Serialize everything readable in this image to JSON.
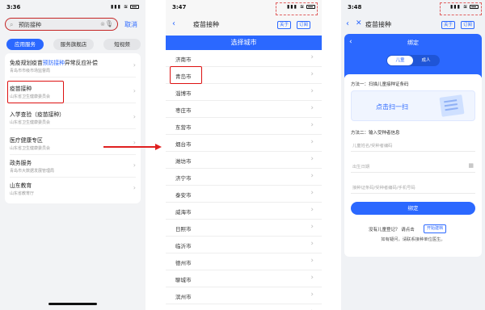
{
  "phone1": {
    "time": "3:36",
    "search": {
      "value": "预防接种",
      "cancel": "取消"
    },
    "tabs": [
      "应用服务",
      "服务旗舰店",
      "短视频"
    ],
    "results": [
      {
        "title_pre": "免疫规划疫苗",
        "title_hl": "预防接种",
        "title_post": "异常反应补偿",
        "sub": "青岛市市级市场监督局"
      },
      {
        "title_pre": "",
        "title_hl": "疫苗接种",
        "title_post": "",
        "sub": "山东省卫生健康委员会"
      },
      {
        "title_pre": "入学查验（",
        "title_hl": "疫苗接种",
        "title_post": "）",
        "sub": "山东省卫生健康委员会"
      },
      {
        "title_pre": "医疗健康专区",
        "title_hl": "",
        "title_post": "",
        "sub": "山东省卫生健康委员会"
      },
      {
        "title_pre": "政务服务",
        "title_hl": "",
        "title_post": "",
        "sub": "青岛市大数据发展管理局"
      },
      {
        "title_pre": "山东教育",
        "title_hl": "",
        "title_post": "",
        "sub": "山东省教育厅"
      }
    ]
  },
  "phone2": {
    "time": "3:47",
    "nav_title": "疫苗接种",
    "pill_about": "关于",
    "pill_sub": "订阅",
    "banner": "选择城市",
    "cities": [
      "济南市",
      "青岛市",
      "淄博市",
      "枣庄市",
      "东营市",
      "烟台市",
      "潍坊市",
      "济宁市",
      "泰安市",
      "威海市",
      "日照市",
      "临沂市",
      "德州市",
      "聊城市",
      "滨州市",
      "菏泽市"
    ]
  },
  "phone3": {
    "time": "3:48",
    "nav_title": "疫苗接种",
    "pill_about": "关于",
    "pill_sub": "订阅",
    "header": "绑定",
    "seg": [
      "儿童",
      "成人"
    ],
    "method1": "方法一：扫描儿童接种证条码",
    "scan_text": "点击扫一扫",
    "method2": "方法二：输入受种者信息",
    "fields": [
      "儿童姓名/受种者编码",
      "出生日期",
      "接种证条码/受种者编码/手机号码"
    ],
    "bind_button": "绑定",
    "register_question": "没有儿童登记？ 请点击",
    "register_button": "开始建档",
    "help": "如有疑问，请联系接种单位医生。"
  }
}
